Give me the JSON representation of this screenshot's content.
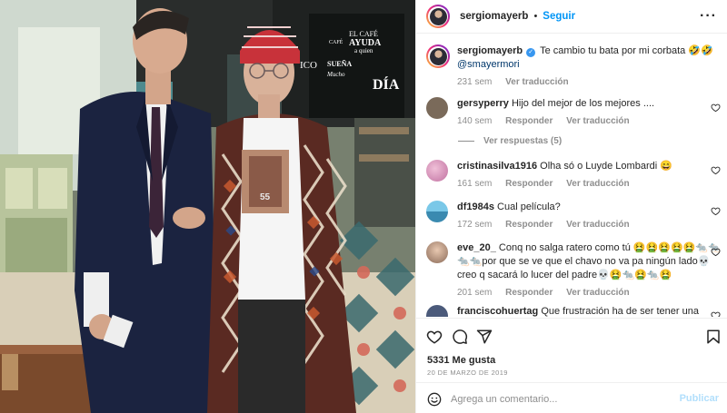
{
  "post": {
    "author": "sergiomayerb",
    "follow_label": "Seguir",
    "dot": "•",
    "more_label": "···",
    "caption_text": "Te cambio tu bata por mi corbata 🤣🤣",
    "caption_mention": "@smayermori",
    "caption_time": "231 sem",
    "translate_label": "Ver traducción",
    "likes": "5331 Me gusta",
    "date": "20 DE MARZO DE 2019"
  },
  "comments": [
    {
      "user": "gersyperry",
      "text": "Hijo del mejor de los mejores ....",
      "time": "140 sem",
      "reply": "Responder",
      "translate": "Ver traducción",
      "avatar_color": "#7a6a5a"
    },
    {
      "user": "cristinasilva1916",
      "text": "Olha só o Luyde Lombardi 😄",
      "time": "161 sem",
      "reply": "Responder",
      "translate": "Ver traducción",
      "avatar_color": "#d6a0c4"
    },
    {
      "user": "df1984s",
      "text": "Cual película?",
      "time": "172 sem",
      "reply": "Responder",
      "translate": "Ver traducción",
      "avatar_color": "#4aa3c8"
    },
    {
      "user": "eve_20_",
      "text": "Conq no salga ratero como tú 🤮🤮🤮🤮🤮🐀🐀🐀🐀por que se ve que el chavo no va pa ningún lado💀creo q sacará lo lucer del padre💀🤮🐀🤮🐀🤮",
      "time": "201 sem",
      "reply": "Responder",
      "translate": "Ver traducción",
      "avatar_color": "#c9a48c"
    },
    {
      "user": "franciscohuertag",
      "text": "Que frustración ha de ser tener una lacra",
      "avatar_color": "#4b5a7a"
    }
  ],
  "replies_label": "Ver respuestas (5)",
  "add_comment": {
    "placeholder": "Agrega un comentario...",
    "publish_label": "Publicar"
  },
  "photo": {
    "sign_lines": [
      "EL CAFÉ",
      "AYUDA",
      "a quien",
      "SUEÑA",
      "Mucho"
    ],
    "sign_small": "CAFÉ",
    "sign_dia": "DÍA",
    "sign_left": "ICO",
    "tshirt_label": "55",
    "colors": {
      "accent": "#0095f6",
      "verified": "#3897f0",
      "beanie": "#c8323a"
    }
  }
}
